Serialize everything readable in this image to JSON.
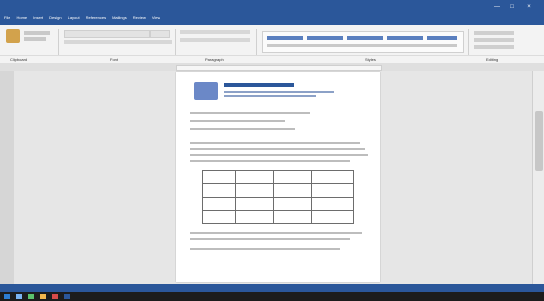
{
  "window": {
    "title": "",
    "controls": {
      "minimize": "—",
      "maximize": "□",
      "close": "×"
    }
  },
  "ribbon": {
    "tabs": [
      "File",
      "Home",
      "Insert",
      "Design",
      "Layout",
      "References",
      "Mailings",
      "Review",
      "View"
    ],
    "active_tab": "Home",
    "groups": [
      "Clipboard",
      "Font",
      "Paragraph",
      "Styles",
      "Editing"
    ]
  },
  "document": {
    "header_title": "",
    "lines": [
      "",
      "",
      "",
      ""
    ],
    "table": {
      "headers": [
        "",
        "",
        "",
        ""
      ],
      "rows": [
        [
          "",
          "",
          "",
          ""
        ],
        [
          "",
          "",
          "",
          ""
        ],
        [
          "",
          "",
          "",
          ""
        ]
      ]
    }
  },
  "status": {
    "page": "",
    "words": "",
    "zoom": ""
  },
  "taskbar": {
    "time": ""
  },
  "colors": {
    "accent": "#2b579a",
    "taskbar": "#1c1c1c"
  }
}
